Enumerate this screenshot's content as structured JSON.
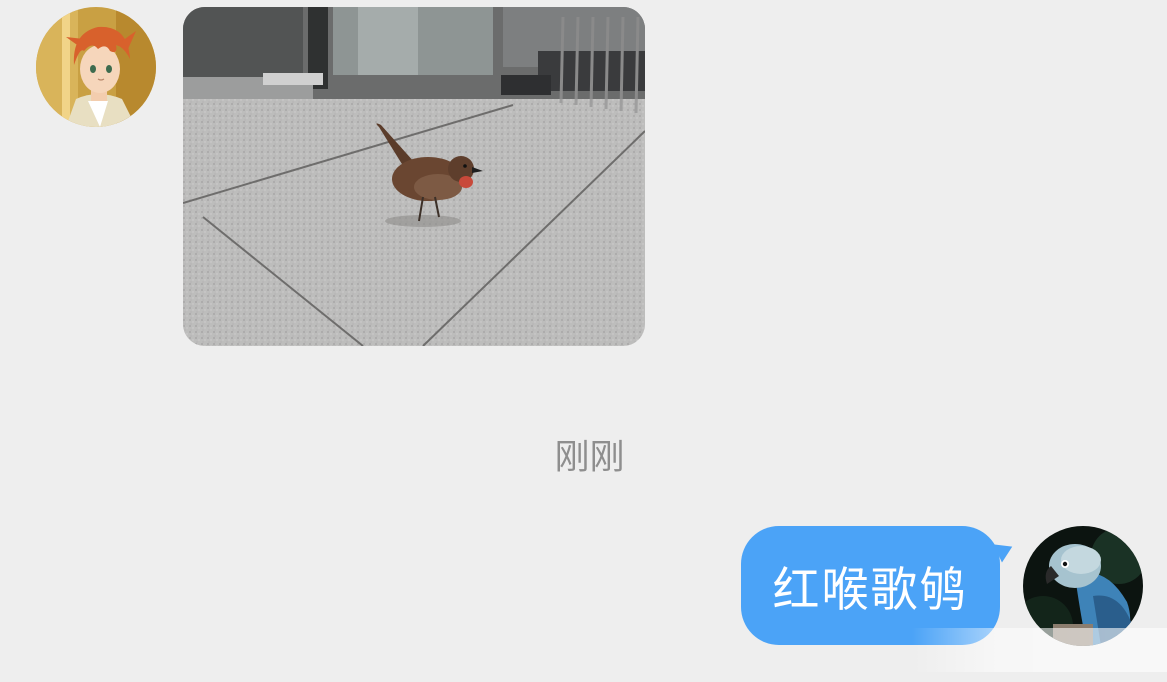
{
  "conversation": {
    "incoming": {
      "avatar_icon": "anime-boy-avatar-icon",
      "photo_subject": "bird-photo"
    },
    "timestamp": "刚刚",
    "outgoing": {
      "text": "红喉歌鸲",
      "avatar_icon": "blue-parrot-avatar-icon"
    }
  },
  "colors": {
    "background": "#EEEEEE",
    "bubble_outgoing": "#4BA3F7",
    "timestamp_text": "#8E8E8E"
  }
}
